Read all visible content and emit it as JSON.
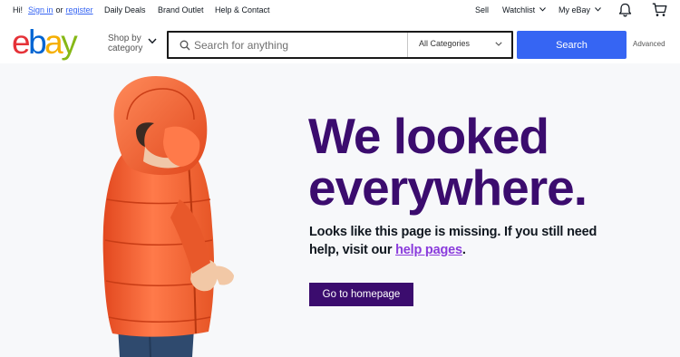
{
  "topbar": {
    "greeting": "Hi!",
    "sign_in": "Sign in",
    "or": "or",
    "register": "register",
    "daily_deals": "Daily Deals",
    "brand_outlet": "Brand Outlet",
    "help_contact": "Help & Contact",
    "sell": "Sell",
    "watchlist": "Watchlist",
    "my_ebay": "My eBay"
  },
  "header": {
    "logo_letters": [
      "e",
      "b",
      "a",
      "y"
    ],
    "logo_colors": [
      "#e53238",
      "#0064d2",
      "#f5af02",
      "#86b817"
    ],
    "shop_by_line1": "Shop by",
    "shop_by_line2": "category",
    "search_placeholder": "Search for anything",
    "category": "All Categories",
    "search_button": "Search",
    "advanced": "Advanced"
  },
  "hero": {
    "headline_line1": "We looked",
    "headline_line2": "everywhere.",
    "sub_before": "Looks like this page is missing. If you still need help, visit our ",
    "sub_link": "help pages",
    "sub_after": ".",
    "cta": "Go to homepage"
  },
  "colors": {
    "primary_blue": "#3665f3",
    "hero_purple": "#3b0c6e",
    "link_purple": "#8a3bdc",
    "jacket_orange": "#ff6a3d"
  }
}
